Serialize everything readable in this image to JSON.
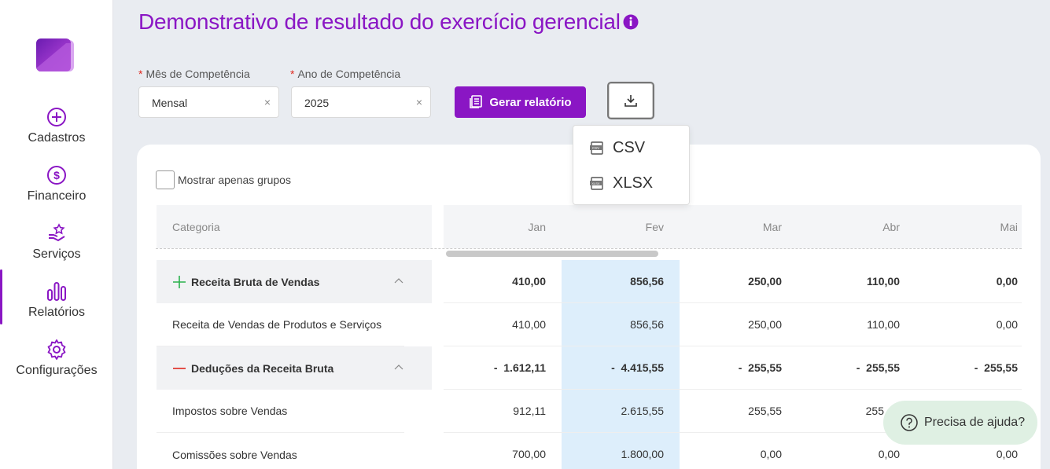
{
  "sidebar": {
    "items": [
      {
        "label": "Cadastros",
        "icon": "plus-circle-icon"
      },
      {
        "label": "Financeiro",
        "icon": "dollar-circle-icon"
      },
      {
        "label": "Serviços",
        "icon": "hand-star-icon"
      },
      {
        "label": "Relatórios",
        "icon": "bar-chart-icon"
      },
      {
        "label": "Configurações",
        "icon": "gear-icon"
      }
    ],
    "active": "Relatórios"
  },
  "page": {
    "title": "Demonstrativo de resultado do exercício gerencial"
  },
  "filters": {
    "mes_label": "Mês de Competência",
    "mes_value": "Mensal",
    "ano_label": "Ano de Competência",
    "ano_value": "2025",
    "required_mark": "*",
    "clear_glyph": "×"
  },
  "actions": {
    "gerar_label": "Gerar relatório"
  },
  "download_menu": {
    "items": [
      "CSV",
      "XLSX"
    ]
  },
  "options": {
    "mostrar_grupos_label": "Mostrar apenas grupos"
  },
  "table": {
    "category_header": "Categoria",
    "months": [
      "Jan",
      "Fev",
      "Mar",
      "Abr",
      "Mai"
    ],
    "rows": [
      {
        "category": "Receita Bruta de Vendas",
        "group": true,
        "sign": "+",
        "values": [
          "410,00",
          "856,56",
          "250,00",
          "110,00",
          "0,00"
        ]
      },
      {
        "category": "Receita de Vendas de Produtos e Serviços",
        "group": false,
        "values": [
          "410,00",
          "856,56",
          "250,00",
          "110,00",
          "0,00"
        ]
      },
      {
        "category": "Deduções da Receita Bruta",
        "group": true,
        "sign": "-",
        "values": [
          "-  1.612,11",
          "-  4.415,55",
          "-  255,55",
          "-  255,55",
          "-  255,55"
        ]
      },
      {
        "category": "Impostos sobre Vendas",
        "group": false,
        "values": [
          "912,11",
          "2.615,55",
          "255,55",
          "255",
          ""
        ]
      },
      {
        "category": "Comissões sobre Vendas",
        "group": false,
        "values": [
          "700,00",
          "1.800,00",
          "0,00",
          "0,00",
          "0,00"
        ]
      }
    ]
  },
  "help": {
    "label": "Precisa de ajuda?"
  },
  "colors": {
    "accent": "#8a16c4",
    "highlight_column": "#ddeefb",
    "positive_mark": "#2bb24c",
    "negative_mark": "#e0281e"
  }
}
